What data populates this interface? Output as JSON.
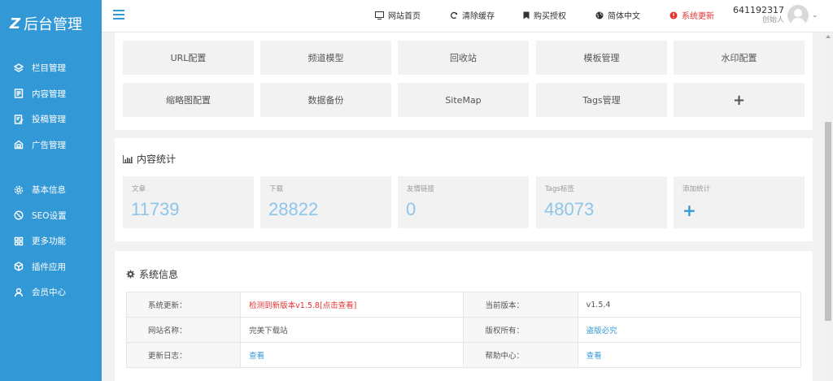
{
  "brand": {
    "mark": "Z",
    "title": "后台管理"
  },
  "sidebar": {
    "groups": [
      [
        {
          "label": "栏目管理",
          "icon": "layers-icon"
        },
        {
          "label": "内容管理",
          "icon": "document-icon"
        },
        {
          "label": "投稿管理",
          "icon": "edit-document-icon"
        },
        {
          "label": "广告管理",
          "icon": "ad-icon"
        }
      ],
      [
        {
          "label": "基本信息",
          "icon": "gear-icon"
        },
        {
          "label": "SEO设置",
          "icon": "compass-icon"
        },
        {
          "label": "更多功能",
          "icon": "grid-icon"
        },
        {
          "label": "插件应用",
          "icon": "box-icon"
        },
        {
          "label": "会员中心",
          "icon": "user-icon"
        }
      ]
    ]
  },
  "header": {
    "links": {
      "home": "网站首页",
      "clear_cache": "清除缓存",
      "buy_license": "购买授权",
      "language": "简体中文",
      "system_update": "系统更新"
    },
    "user": {
      "id": "641192317",
      "role": "创始人"
    }
  },
  "quick_buttons": [
    "URL配置",
    "频道模型",
    "回收站",
    "模板管理",
    "水印配置",
    "缩略图配置",
    "数据备份",
    "SiteMap",
    "Tags管理",
    "+"
  ],
  "stats": {
    "title": "内容统计",
    "items": [
      {
        "label": "文章",
        "value": "11739"
      },
      {
        "label": "下载",
        "value": "28822"
      },
      {
        "label": "友情链接",
        "value": "0"
      },
      {
        "label": "Tags标签",
        "value": "48073"
      },
      {
        "label": "添加统计",
        "value": "+"
      }
    ]
  },
  "system_info": {
    "title": "系统信息",
    "rows": [
      {
        "k1": "系统更新：",
        "v1": "检测到新版本v1.5.8[点击查看]",
        "k2": "当前版本：",
        "v2": "v1.5.4"
      },
      {
        "k1": "网站名称：",
        "v1": "完美下载站",
        "k2": "版权所有：",
        "v2": "盗版必究"
      },
      {
        "k1": "更新日志：",
        "v1": "查看",
        "k2": "帮助中心：",
        "v2": "查看"
      }
    ]
  },
  "colors": {
    "sidebar": "#3399d6",
    "accent": "#3399d6",
    "alert": "#e53333",
    "stat_value": "#8ec5ea"
  }
}
